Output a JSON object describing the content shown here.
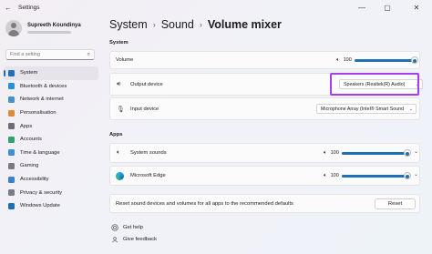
{
  "window": {
    "back_glyph": "←",
    "title": "Settings",
    "minimize_glyph": "—",
    "maximize_glyph": "▢",
    "close_glyph": "✕"
  },
  "profile": {
    "name": "Supreeth Koundinya"
  },
  "search": {
    "placeholder": "Find a setting",
    "icon": "search-icon",
    "glyph": "⌕"
  },
  "nav": [
    {
      "label": "System",
      "icon": "monitor-icon",
      "color": "#1f6fb7",
      "active": true
    },
    {
      "label": "Bluetooth & devices",
      "icon": "bluetooth-icon",
      "color": "#2b8fd6"
    },
    {
      "label": "Network & internet",
      "icon": "wifi-icon",
      "color": "#4a90c9"
    },
    {
      "label": "Personalisation",
      "icon": "brush-icon",
      "color": "#e08a3c"
    },
    {
      "label": "Apps",
      "icon": "apps-icon",
      "color": "#6d6d7a"
    },
    {
      "label": "Accounts",
      "icon": "person-icon",
      "color": "#2fa36b"
    },
    {
      "label": "Time & language",
      "icon": "globe-icon",
      "color": "#3c8fd1"
    },
    {
      "label": "Gaming",
      "icon": "gamepad-icon",
      "color": "#7a7a86"
    },
    {
      "label": "Accessibility",
      "icon": "accessibility-icon",
      "color": "#3a7fd0"
    },
    {
      "label": "Privacy & security",
      "icon": "shield-icon",
      "color": "#7b7b88"
    },
    {
      "label": "Windows Update",
      "icon": "update-icon",
      "color": "#1f6fb7"
    }
  ],
  "breadcrumb": {
    "part1": "System",
    "part2": "Sound",
    "current": "Volume mixer",
    "sep": "›"
  },
  "system_section": {
    "heading": "System",
    "volume_label": "Volume",
    "volume_value": "100",
    "volume_level": 1.0,
    "output_label": "Output device",
    "output_value": "Speakers (Realtek(R) Audio)",
    "input_label": "Input device",
    "input_value": "Microphone Array (Intel® Smart Sound"
  },
  "apps_section": {
    "heading": "Apps",
    "apps": [
      {
        "name": "System sounds",
        "volume": "100",
        "level": 1.0
      },
      {
        "name": "Microsoft Edge",
        "volume": "100",
        "level": 1.0
      }
    ],
    "reset_text": "Reset sound devices and volumes for all apps to the recommended defaults",
    "reset_button": "Reset"
  },
  "links": {
    "help": "Get help",
    "feedback": "Give feedback"
  },
  "icons": {
    "speaker": "🔈︎",
    "output_speaker": "🔊︎",
    "mic": "🎙︎",
    "chevron_down": "⌄",
    "dropdown_chevron": "⌄"
  },
  "colors": {
    "accent": "#1f6fb7",
    "highlight": "#a63df1"
  }
}
